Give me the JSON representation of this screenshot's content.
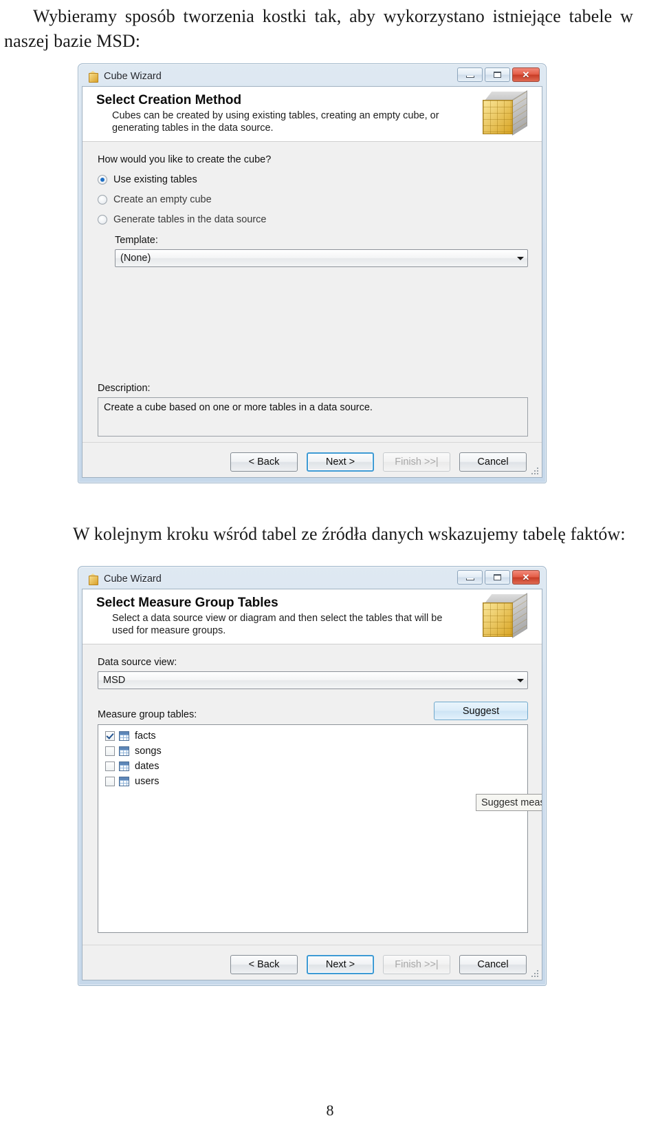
{
  "document": {
    "paragraph_1": "Wybieramy sposób tworzenia kostki tak, aby wykorzystano istniejące tabele w naszej bazie MSD:",
    "paragraph_2": "W kolejnym kroku wśród tabel ze źródła danych wskazujemy tabelę faktów:",
    "page_number": "8"
  },
  "dialog1": {
    "window_title": "Cube Wizard",
    "title_icon": "cube-icon",
    "window_controls": {
      "minimize": "minimize-icon",
      "maximize": "maximize-icon",
      "close": "✕"
    },
    "header": {
      "title": "Select Creation Method",
      "subtitle": "Cubes can be created by using existing tables, creating an empty cube, or generating tables in the data source."
    },
    "question": "How would you like to create the cube?",
    "options": [
      {
        "label": "Use existing tables",
        "accel": "U",
        "selected": true,
        "enabled": true
      },
      {
        "label": "Create an empty cube",
        "accel": "C",
        "selected": false,
        "enabled": true
      },
      {
        "label": "Generate tables in the data source",
        "accel": "G",
        "selected": false,
        "enabled": true
      }
    ],
    "template_label": "Template:",
    "template_accel": "T",
    "template_value": "(None)",
    "description_label": "Description:",
    "description_value": "Create a cube based on one or more tables in a data source.",
    "buttons": [
      {
        "label": "< Back",
        "accel": "B",
        "state": "normal"
      },
      {
        "label": "Next >",
        "accel": "N",
        "state": "default"
      },
      {
        "label": "Finish >>|",
        "accel": "F",
        "state": "disabled"
      },
      {
        "label": "Cancel",
        "accel": "",
        "state": "normal"
      }
    ]
  },
  "dialog2": {
    "window_title": "Cube Wizard",
    "title_icon": "cube-icon",
    "window_controls": {
      "minimize": "minimize-icon",
      "maximize": "maximize-icon",
      "close": "✕"
    },
    "header": {
      "title": "Select Measure Group Tables",
      "subtitle": "Select a data source view or diagram and then select the tables that will be used for measure groups."
    },
    "data_source_view_label": "Data source view:",
    "data_source_view_accel": "D",
    "data_source_view_value": "MSD",
    "measure_group_tables_label": "Measure group tables:",
    "measure_group_tables_accel": "M",
    "suggest_button": "Suggest",
    "suggest_accel": "S",
    "tooltip": "Suggest meas",
    "tables": [
      {
        "name": "facts",
        "checked": true
      },
      {
        "name": "songs",
        "checked": false
      },
      {
        "name": "dates",
        "checked": false
      },
      {
        "name": "users",
        "checked": false
      }
    ],
    "buttons": [
      {
        "label": "< Back",
        "accel": "B",
        "state": "normal"
      },
      {
        "label": "Next >",
        "accel": "N",
        "state": "default"
      },
      {
        "label": "Finish >>|",
        "accel": "F",
        "state": "disabled"
      },
      {
        "label": "Cancel",
        "accel": "",
        "state": "normal"
      }
    ]
  },
  "colors": {
    "accent_blue": "#3d9ad4",
    "title_gradient_top": "#dfe9f2",
    "close_red": "#e35c46",
    "cube_yellow": "#d8a424"
  }
}
